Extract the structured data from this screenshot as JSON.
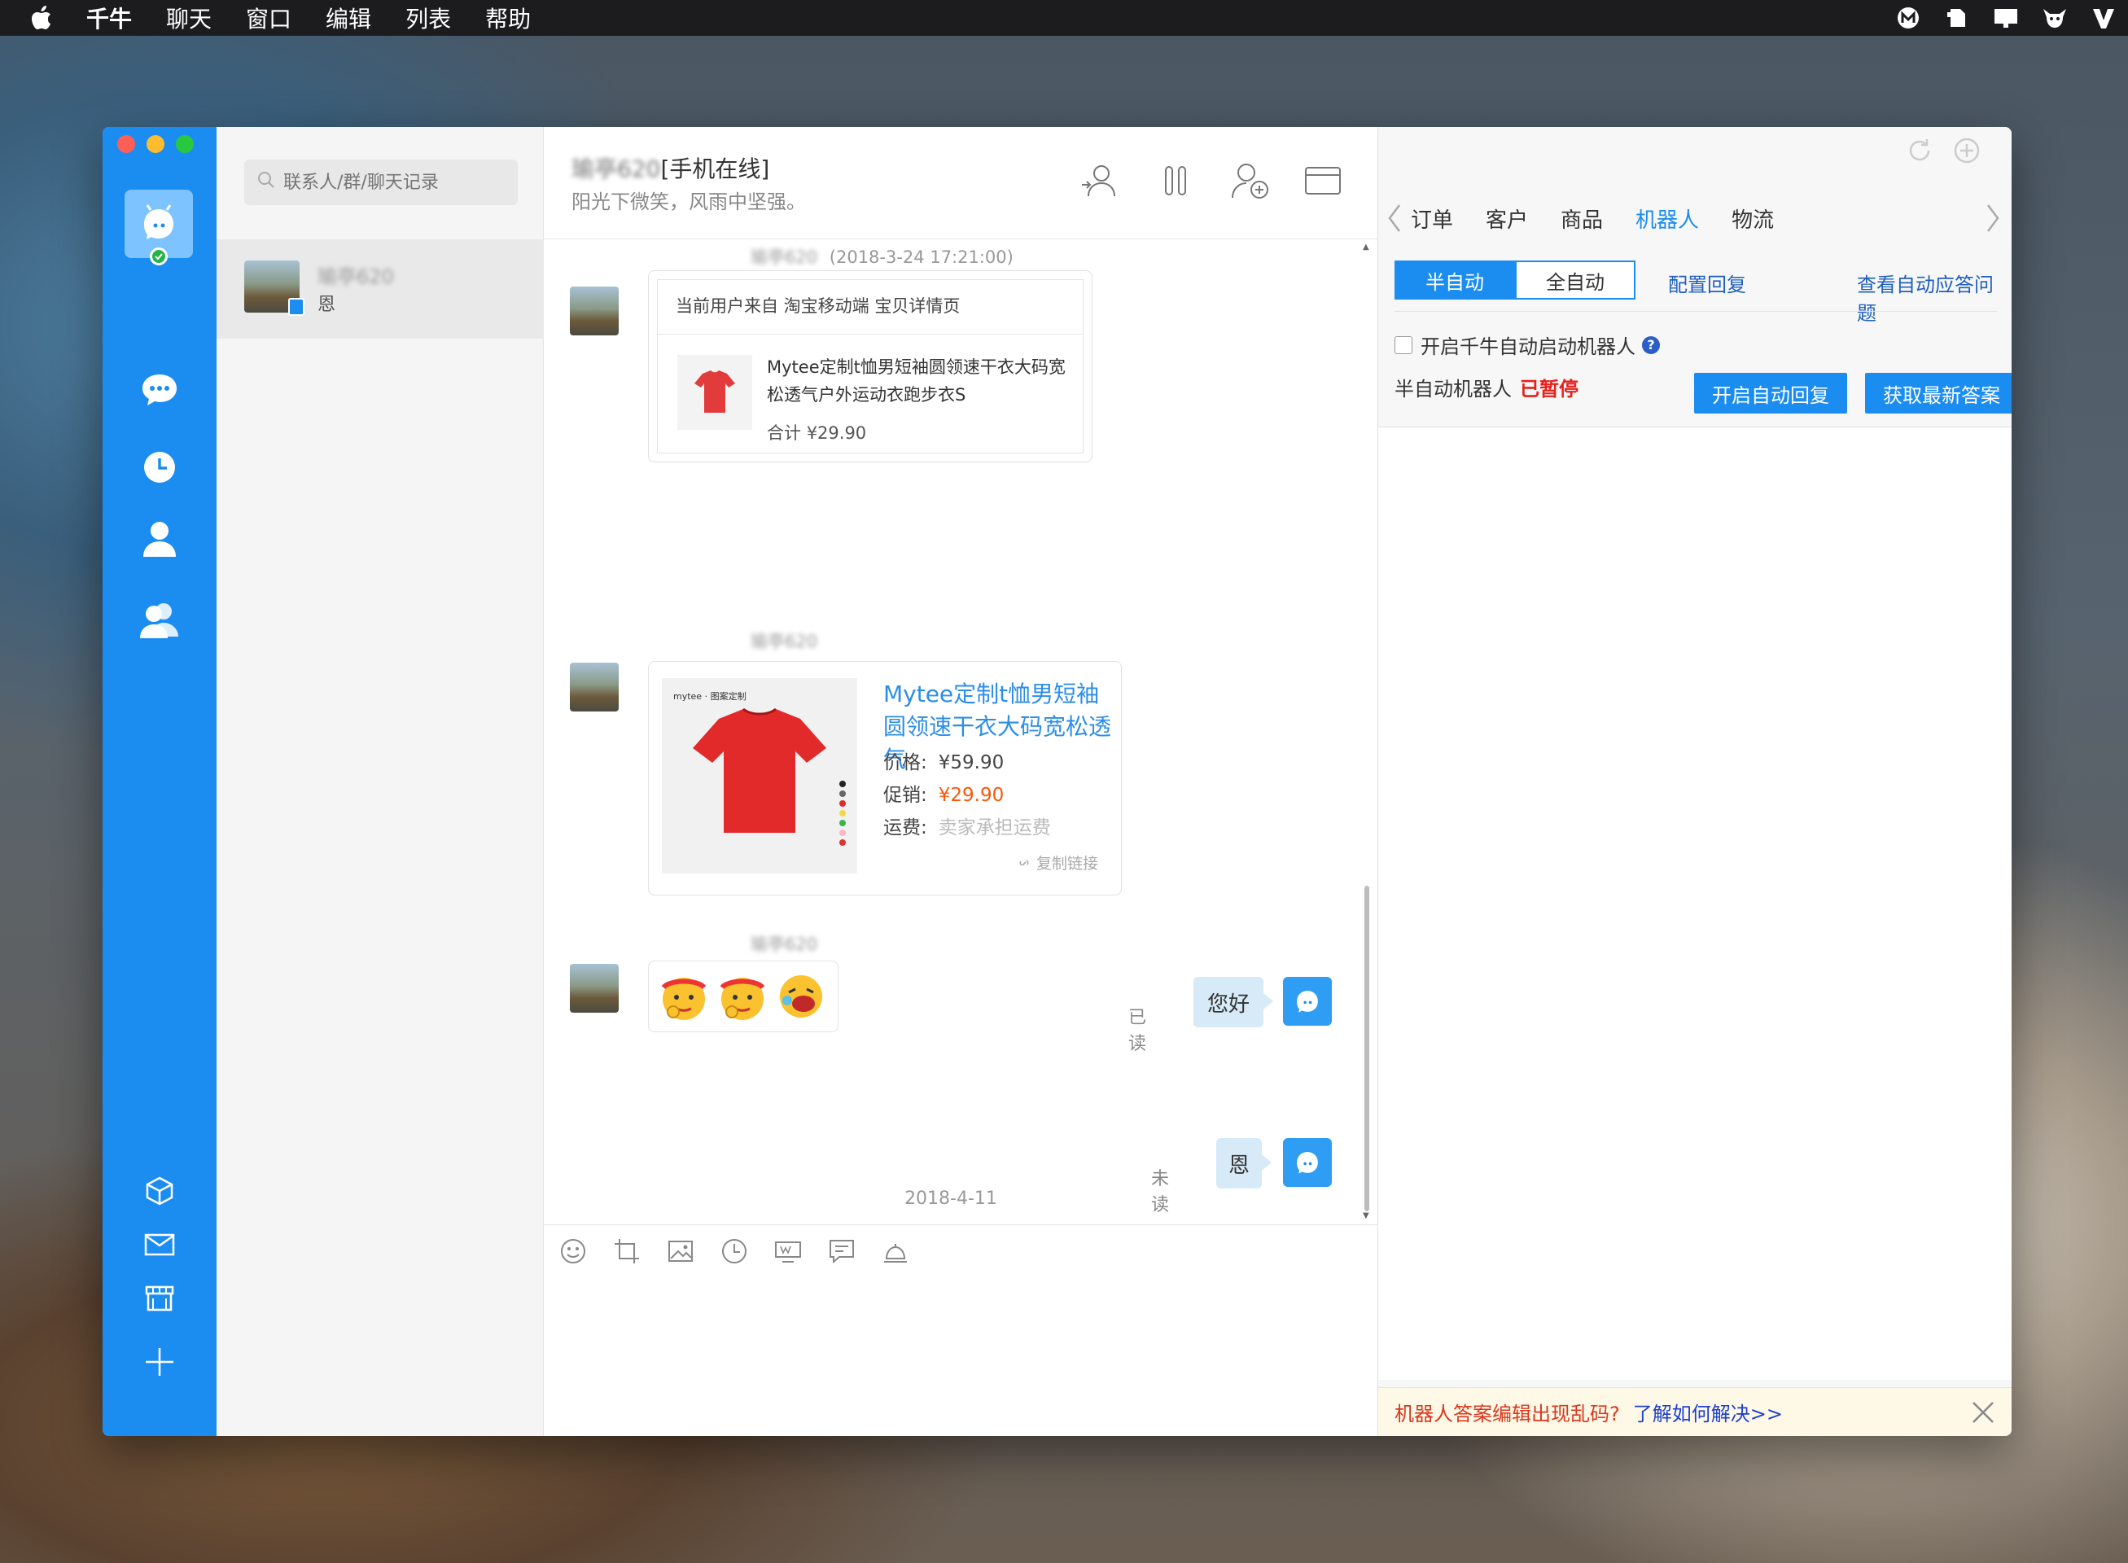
{
  "menubar": {
    "app_name": "千牛",
    "items": [
      "聊天",
      "窗口",
      "编辑",
      "列表",
      "帮助"
    ],
    "tray_icons": [
      "m-circle-icon",
      "evernote-icon",
      "screen-icon",
      "cow-icon",
      "v-logo-icon"
    ]
  },
  "contacts": {
    "search_placeholder": "联系人/群/聊天记录",
    "items": [
      {
        "name": "瑜亭620",
        "last_message": "恩"
      }
    ]
  },
  "chat": {
    "title_name": "瑜亭620",
    "title_status": "[手机在线]",
    "signature": "阳光下微笑，风雨中坚强。",
    "messages": {
      "m1": {
        "sender": "瑜亭620",
        "time": "(2018-3-24 17:21:00)",
        "source": "当前用户来自 淘宝移动端 宝贝详情页",
        "product_title": "Mytee定制t恤男短袖圆领速干衣大码宽松透气户外运动衣跑步衣S",
        "total_label": "合计",
        "total": "¥29.90"
      },
      "m2": {
        "sender": "瑜亭620",
        "product_title": "Mytee定制t恤男短袖圆领速干衣大码宽松透气",
        "price_label": "价格:",
        "price": "¥59.90",
        "promo_label": "促销:",
        "promo": "¥29.90",
        "ship_label": "运费:",
        "ship": "卖家承担运费",
        "copy_link": "复制链接",
        "image_brand": "mytee · 图案定制"
      },
      "m3": {
        "sender": "瑜亭620"
      },
      "m4": {
        "status": "已读",
        "text": "您好"
      },
      "date_separator": "2018-4-11",
      "m5": {
        "status": "未读",
        "text": "恩"
      }
    }
  },
  "side": {
    "tabs": [
      "订单",
      "客户",
      "商品",
      "机器人",
      "物流"
    ],
    "active_tab": "机器人",
    "mode_semi": "半自动",
    "mode_full": "全自动",
    "config_reply": "配置回复",
    "view_questions": "查看自动应答问题",
    "auto_start_label": "开启千牛自动启动机器人",
    "robot_label": "半自动机器人",
    "robot_state": "已暂停",
    "start_auto_reply": "开启自动回复",
    "fetch_answers": "获取最新答案",
    "notice_warning": "机器人答案编辑出现乱码?",
    "notice_link": "了解如何解决>>"
  },
  "colors": {
    "accent": "#1c8df0",
    "promo": "#f5590b",
    "paused": "#e8201c",
    "link": "#1f5fbf"
  }
}
